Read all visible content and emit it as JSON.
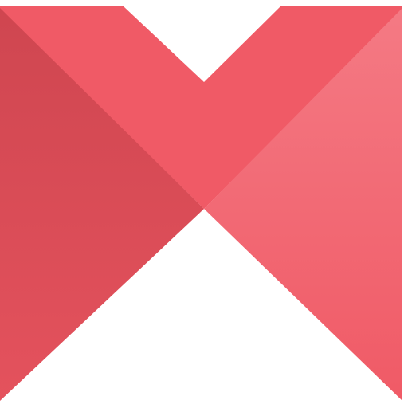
{
  "logo": {
    "icon": "m-logo-icon",
    "colors": {
      "left_dark": "#cf4650",
      "left_bottom": "#e4525d",
      "center_band": "#f05a66",
      "right_light": "#f47a84",
      "right_bottom": "#f05a66",
      "background": "#ffffff"
    }
  }
}
